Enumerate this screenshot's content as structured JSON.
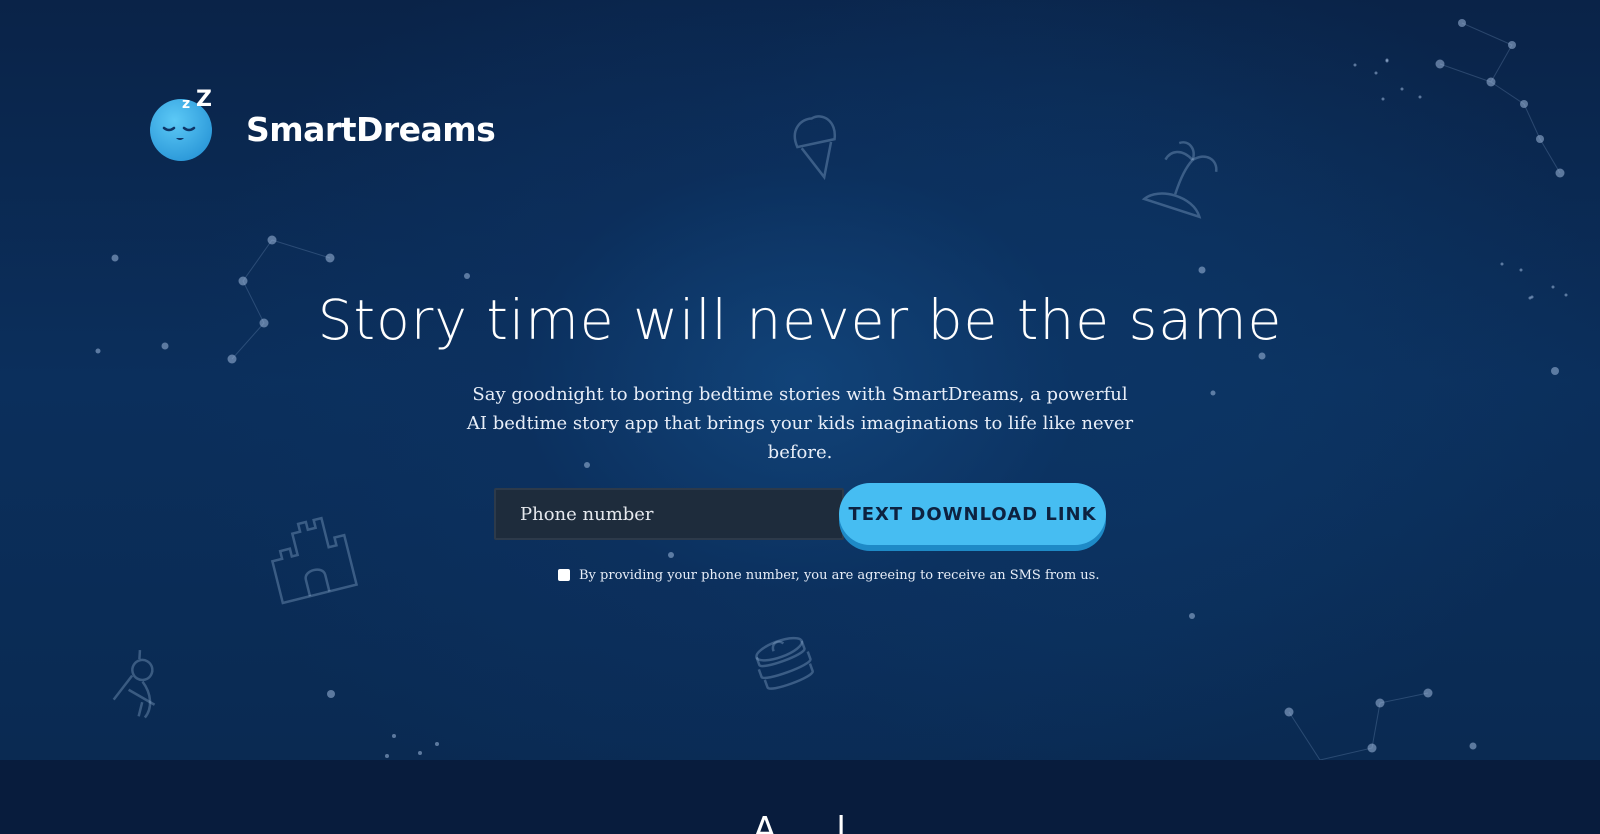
{
  "brand": {
    "name": "SmartDreams",
    "logo_icon": "sleeping-moon-icon"
  },
  "hero": {
    "headline": "Story time will never be the same",
    "subtitle": "Say goodnight to boring bedtime stories with SmartDreams, a powerful AI bedtime story app that brings your kids imaginations to life like never before."
  },
  "form": {
    "phone_placeholder": "Phone number",
    "phone_value": "",
    "button_label": "TEXT DOWNLOAD LINK",
    "consent_checked": false,
    "consent_text": "By providing your phone number, you are agreeing to receive an SMS from us."
  },
  "next_section": {
    "heading": "A ... l"
  },
  "decorations": [
    "ice-cream-icon",
    "palm-tree-island-icon",
    "castle-icon",
    "teddy-dog-icon",
    "pancake-stack-icon",
    "constellation"
  ],
  "colors": {
    "background": "#0b2f5c",
    "accent": "#46bdf2",
    "accent_shadow": "#1e8ac7",
    "input_bg": "#1e2c3c"
  }
}
